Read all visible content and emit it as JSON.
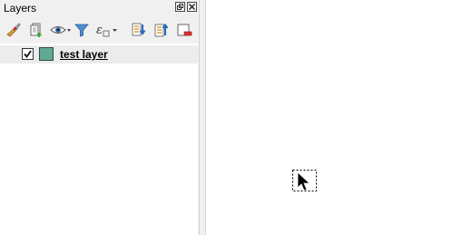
{
  "panel": {
    "title": "Layers",
    "float_icon": "float-dock-icon",
    "close_icon": "close-icon"
  },
  "toolbar": {
    "items": [
      {
        "name": "style-manager-icon"
      },
      {
        "name": "add-group-icon"
      },
      {
        "name": "visibility-eye-icon"
      },
      {
        "name": "filter-legend-icon"
      },
      {
        "name": "filter-expression-icon"
      },
      {
        "name": "expand-all-icon"
      },
      {
        "name": "collapse-all-icon"
      },
      {
        "name": "remove-layer-icon"
      }
    ]
  },
  "layers": [
    {
      "name": "test layer",
      "checked": true,
      "symbol_color": "#5fa995"
    }
  ],
  "map": {
    "background": "#ffffff",
    "cursor_icon": "move-cursor-icon"
  }
}
